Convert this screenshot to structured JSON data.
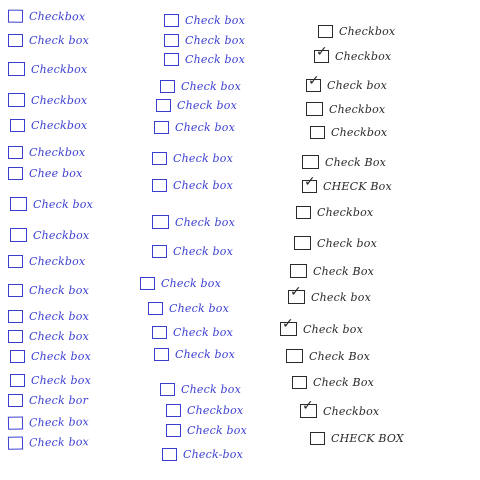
{
  "ink": {
    "blue": "#3b3fd0",
    "black": "#2a2a2a"
  },
  "columns": [
    {
      "ink": "blue",
      "items": [
        {
          "label": "Checkbox",
          "checked": false
        },
        {
          "label": "Check box",
          "checked": false
        },
        {
          "label": "Checkbox",
          "checked": false
        },
        {
          "label": "Checkbox",
          "checked": false
        },
        {
          "label": "Checkbox",
          "checked": false
        },
        {
          "label": "Checkbox",
          "checked": false
        },
        {
          "label": "Chee box",
          "checked": false
        },
        {
          "label": "Check box",
          "checked": false
        },
        {
          "label": "Checkbox",
          "checked": false
        },
        {
          "label": "Checkbox",
          "checked": false
        },
        {
          "label": "Check box",
          "checked": false
        },
        {
          "label": "Check box",
          "checked": false
        },
        {
          "label": "Check box",
          "checked": false
        },
        {
          "label": "Check box",
          "checked": false
        },
        {
          "label": "Check box",
          "checked": false
        },
        {
          "label": "Check bor",
          "checked": false
        },
        {
          "label": "Check box",
          "checked": false
        },
        {
          "label": "Check box",
          "checked": false
        }
      ]
    },
    {
      "ink": "blue",
      "items": [
        {
          "label": "Check box",
          "checked": false
        },
        {
          "label": "Check box",
          "checked": false
        },
        {
          "label": "Check box",
          "checked": false
        },
        {
          "label": "Check box",
          "checked": false
        },
        {
          "label": "Check box",
          "checked": false
        },
        {
          "label": "Check box",
          "checked": false
        },
        {
          "label": "Check box",
          "checked": false
        },
        {
          "label": "Check box",
          "checked": false
        },
        {
          "label": "Check box",
          "checked": false
        },
        {
          "label": "Check box",
          "checked": false
        },
        {
          "label": "Check box",
          "checked": false
        },
        {
          "label": "Check box",
          "checked": false
        },
        {
          "label": "Check box",
          "checked": false
        },
        {
          "label": "Check box",
          "checked": false
        },
        {
          "label": "Check box",
          "checked": false
        },
        {
          "label": "Checkbox",
          "checked": false
        },
        {
          "label": "Check box",
          "checked": false
        },
        {
          "label": "Check-box",
          "checked": false
        }
      ]
    },
    {
      "ink": "black",
      "items": [
        {
          "label": "Checkbox",
          "checked": false
        },
        {
          "label": "Checkbox",
          "checked": true
        },
        {
          "label": "Check box",
          "checked": true
        },
        {
          "label": "Checkbox",
          "checked": false
        },
        {
          "label": "Checkbox",
          "checked": false
        },
        {
          "label": "Check Box",
          "checked": false
        },
        {
          "label": "CHECK Box",
          "checked": true
        },
        {
          "label": "Checkbox",
          "checked": false
        },
        {
          "label": "Check box",
          "checked": false
        },
        {
          "label": "Check Box",
          "checked": false
        },
        {
          "label": "Check box",
          "checked": true
        },
        {
          "label": "Check box",
          "checked": true
        },
        {
          "label": "Check Box",
          "checked": false
        },
        {
          "label": "Check Box",
          "checked": false
        },
        {
          "label": "Checkbox",
          "checked": true
        },
        {
          "label": "CHECK BOX",
          "checked": false
        }
      ]
    }
  ]
}
